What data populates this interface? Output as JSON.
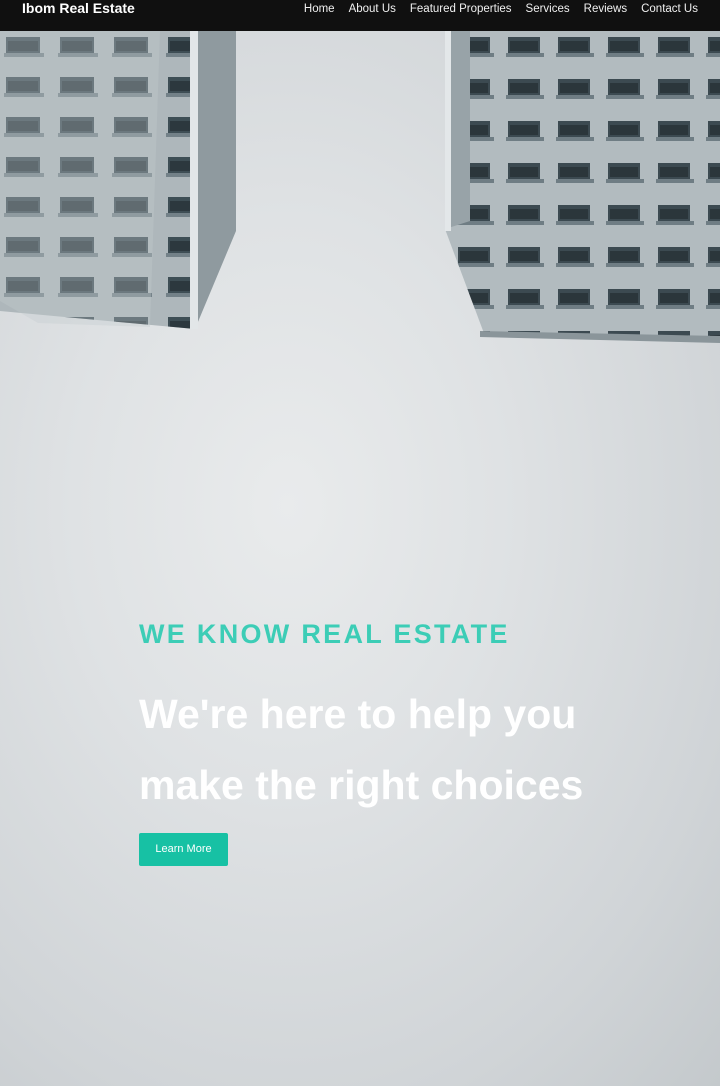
{
  "nav": {
    "brand": "Ibom Real Estate",
    "links": [
      "Home",
      "About Us",
      "Featured Properties",
      "Services",
      "Reviews",
      "Contact Us"
    ]
  },
  "hero": {
    "eyebrow": "WE KNOW REAL ESTATE",
    "headline": "We're here to help you make the right choices",
    "cta_label": "Learn More"
  },
  "colors": {
    "navbar_bg": "#101010",
    "accent": "#3ccdb6",
    "button_bg": "#17c1a4"
  }
}
